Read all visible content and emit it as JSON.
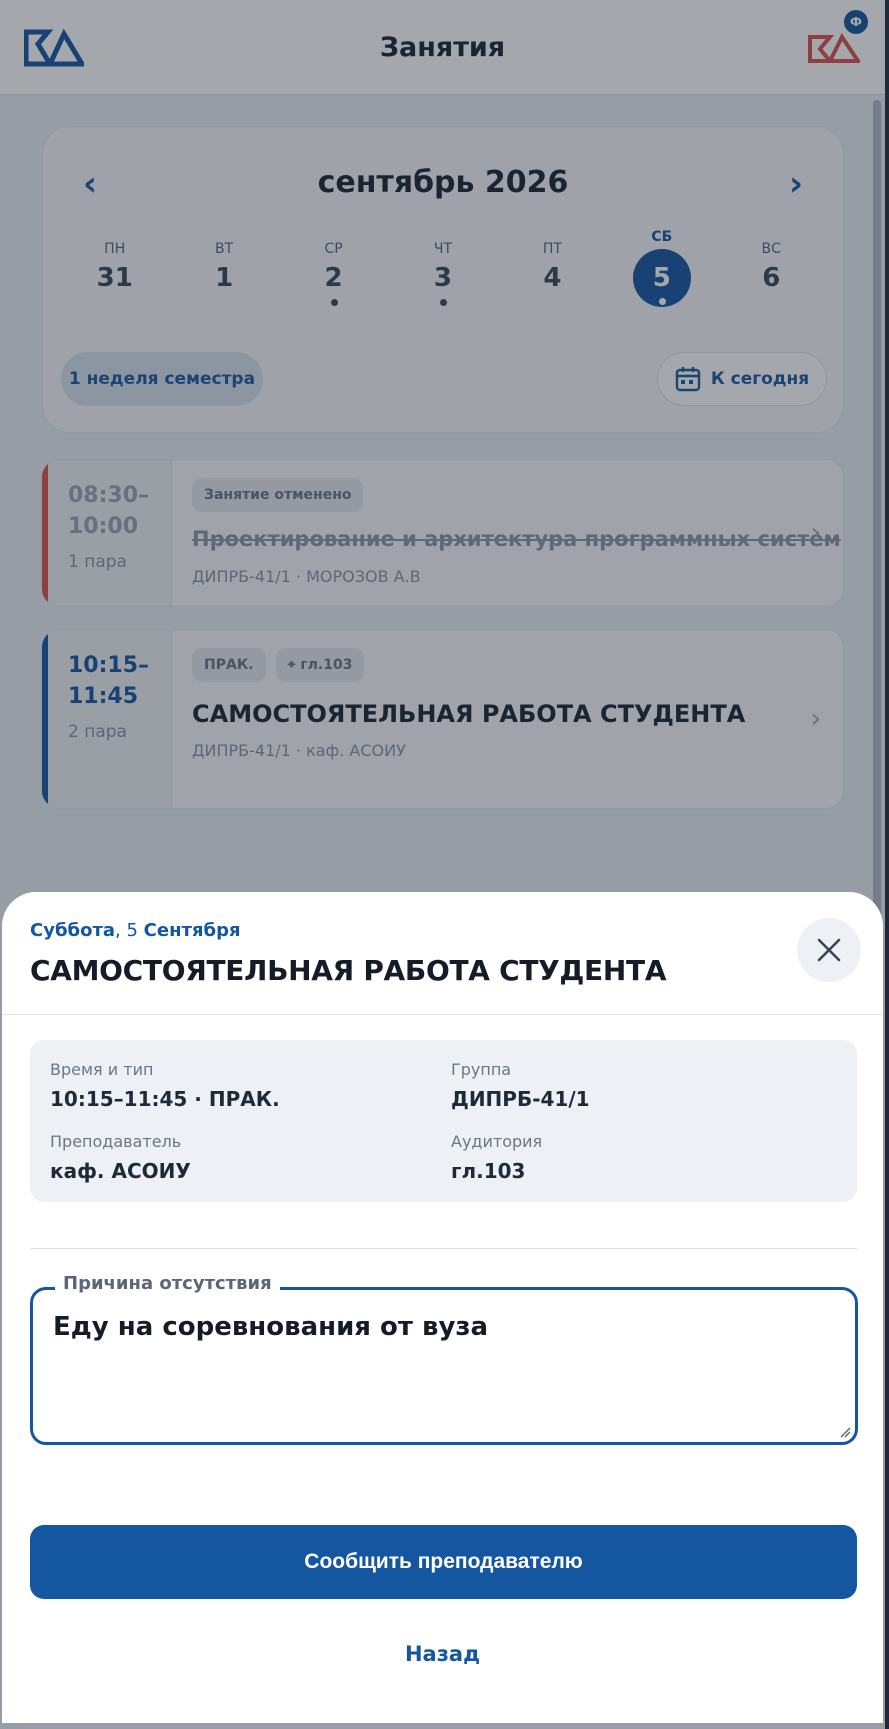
{
  "header": {
    "title": "Занятия",
    "notification_badge": "Ф"
  },
  "calendar": {
    "prev_glyph": "‹",
    "next_glyph": "›",
    "month_label": "сентябрь 2026",
    "days": [
      {
        "name": "ПН",
        "date": "31",
        "has_lessons": false,
        "selected": false
      },
      {
        "name": "ВТ",
        "date": "1",
        "has_lessons": false,
        "selected": false
      },
      {
        "name": "СР",
        "date": "2",
        "has_lessons": true,
        "selected": false
      },
      {
        "name": "ЧТ",
        "date": "3",
        "has_lessons": true,
        "selected": false
      },
      {
        "name": "ПТ",
        "date": "4",
        "has_lessons": false,
        "selected": false
      },
      {
        "name": "СБ",
        "date": "5",
        "has_lessons": true,
        "selected": true
      },
      {
        "name": "ВС",
        "date": "6",
        "has_lessons": false,
        "selected": false
      }
    ],
    "week_label": "1 неделя семестра",
    "today_label": "К сегодня"
  },
  "lessons": [
    {
      "time": "08:30–\n10:00",
      "pair": "1 пара",
      "badges": [
        "Занятие отменено"
      ],
      "title": "Проектирование и архитектура программных систем",
      "meta": "ДИПРБ-41/1 · МОРОЗОВ А.В",
      "cancelled": true,
      "accent": "#d9534f"
    },
    {
      "time": "10:15–\n11:45",
      "pair": "2 пара",
      "badges": [
        "ПРАК.",
        "⌖ гл.103"
      ],
      "title": "САМОСТОЯТЕЛЬНАЯ РАБОТА СТУДЕНТА",
      "meta": "ДИПРБ-41/1 · каф. АСОИУ",
      "cancelled": false,
      "accent": "#1457a0"
    }
  ],
  "sheet": {
    "weekday": "Суббота",
    "date_sep": ", 5 ",
    "month": "Сентября",
    "title": "САМОСТОЯТЕЛЬНАЯ РАБОТА СТУДЕНТА",
    "info": {
      "time_label": "Время и тип",
      "time_value": "10:15–11:45 · ПРАК.",
      "group_label": "Группа",
      "group_value": "ДИПРБ-41/1",
      "teacher_label": "Преподаватель",
      "teacher_value": "каф. АСОИУ",
      "room_label": "Аудитория",
      "room_value": "гл.103"
    },
    "reason_label": "Причина отсутствия",
    "reason_value": "Еду на соревнования от вуза",
    "submit_label": "Сообщить преподавателю",
    "back_label": "Назад"
  },
  "colors": {
    "accent": "#1457a0",
    "cancelled": "#d9534f",
    "overlay": "rgba(28,36,48,0.40)"
  }
}
